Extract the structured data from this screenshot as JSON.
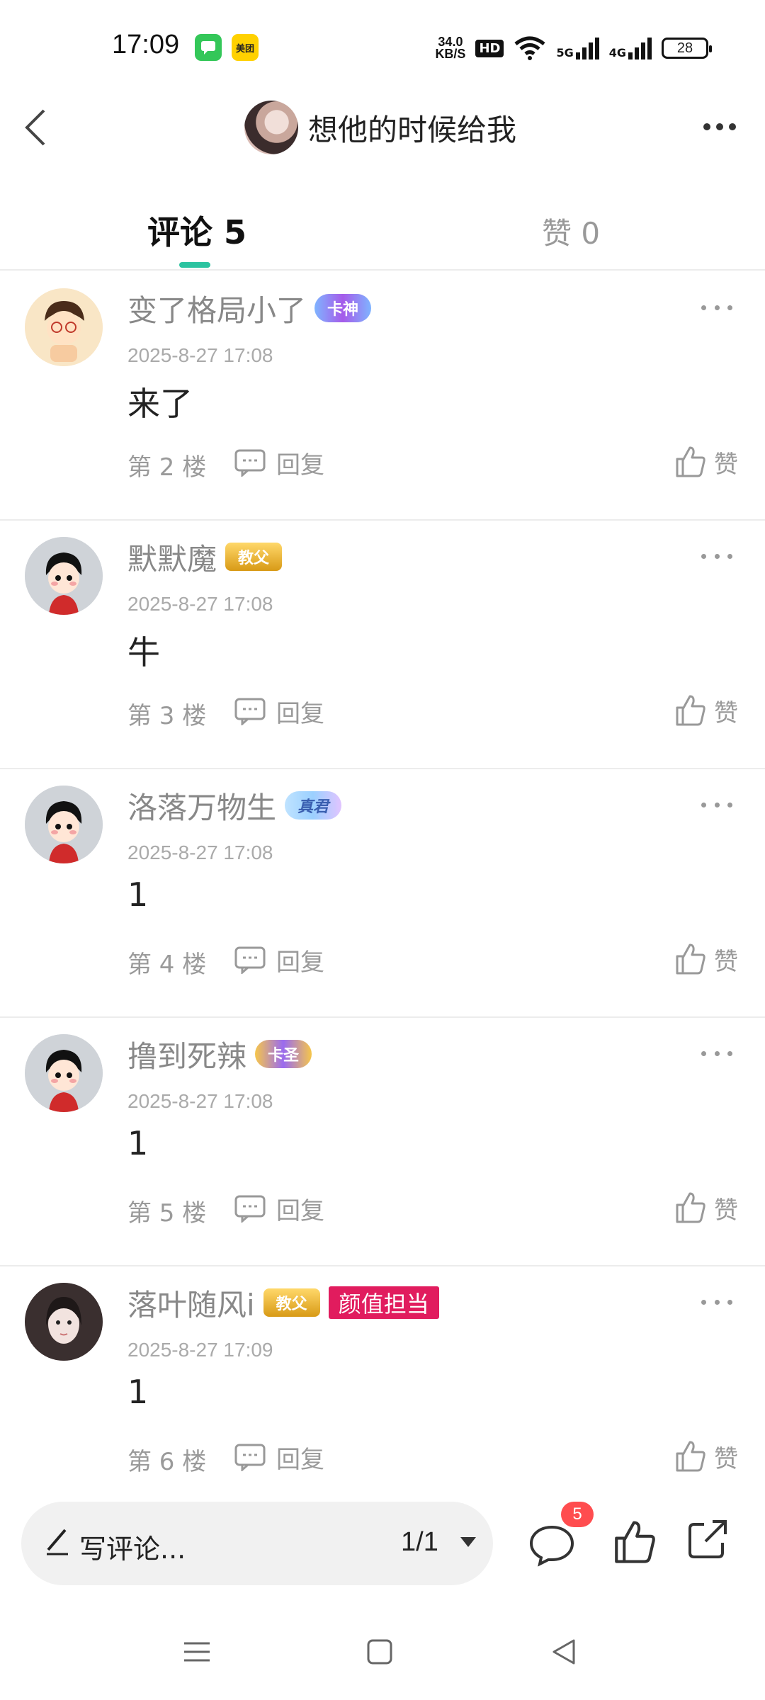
{
  "status_bar": {
    "time": "17:09",
    "app_badges": [
      "美团"
    ],
    "net_speed_value": "34.0",
    "net_speed_unit": "KB/S",
    "hd_label": "HD",
    "net_5g": "5G",
    "net_4g": "4G",
    "battery": "28"
  },
  "header": {
    "title": "想他的时候给我"
  },
  "tabs": {
    "comments_label": "评论 5",
    "likes_label": "赞 0"
  },
  "comments": [
    {
      "name": "变了格局小了",
      "badge": "卡神",
      "time": "2025-8-27 17:08",
      "content": "来了",
      "floor": "第 2 楼",
      "reply": "回复",
      "like": "赞"
    },
    {
      "name": "默默魔",
      "badge": "教父",
      "time": "2025-8-27 17:08",
      "content": "牛",
      "floor": "第 3 楼",
      "reply": "回复",
      "like": "赞"
    },
    {
      "name": "洛落万物生",
      "badge": "真君",
      "time": "2025-8-27 17:08",
      "content": "1",
      "floor": "第 4 楼",
      "reply": "回复",
      "like": "赞"
    },
    {
      "name": "撸到死辣",
      "badge": "卡圣",
      "time": "2025-8-27 17:08",
      "content": "1",
      "floor": "第 5 楼",
      "reply": "回复",
      "like": "赞"
    },
    {
      "name": "落叶随风i",
      "badge": "教父",
      "tag": "颜值担当",
      "time": "2025-8-27 17:09",
      "content": "1",
      "floor": "第 6 楼",
      "reply": "回复",
      "like": "赞"
    }
  ],
  "bottom_bar": {
    "write_placeholder": "写评论...",
    "pager": "1/1",
    "comment_count": "5"
  },
  "colors": {
    "accent": "#2bc3a0",
    "tag_red": "#e11c5e",
    "count_badge": "#ff4d4f"
  }
}
